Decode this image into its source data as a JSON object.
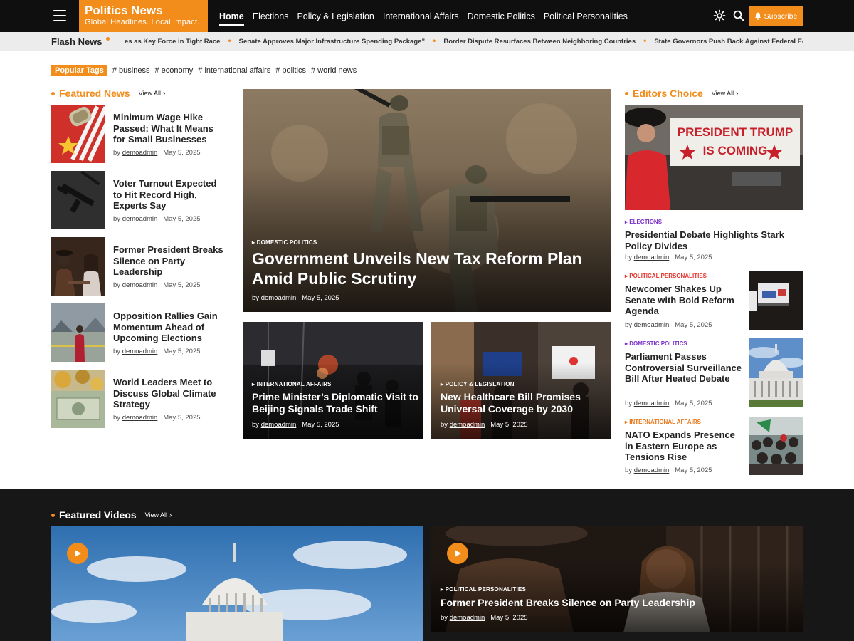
{
  "header": {
    "logo_title": "Politics News",
    "logo_subtitle": "Global Headlines. Local Impact.",
    "nav": [
      "Home",
      "Elections",
      "Policy & Legislation",
      "International Affairs",
      "Domestic Politics",
      "Political Personalities"
    ],
    "subscribe_label": "Subscribe",
    "accent_color": "#f28c1a"
  },
  "flash": {
    "label": "Flash News",
    "items": [
      "es as Key Force in Tight Race",
      "Senate Approves Major Infrastructure Spending Package”",
      "Border Dispute Resurfaces Between Neighboring Countries",
      "State Governors Push Back Against Federal Ed"
    ]
  },
  "tags": {
    "label": "Popular Tags",
    "items": [
      "# business",
      "# economy",
      "# international affairs",
      "# politics",
      "# world news"
    ]
  },
  "featured_news": {
    "title": "Featured News",
    "view_all": "View All",
    "items": [
      {
        "title": "Minimum Wage Hike Passed: What It Means for Small Businesses",
        "by": "by",
        "author": "demoadmin",
        "date": "May 5, 2025"
      },
      {
        "title": "Voter Turnout Expected to Hit Record High, Experts Say",
        "by": "by",
        "author": "demoadmin",
        "date": "May 5, 2025"
      },
      {
        "title": "Former President Breaks Silence on Party Leadership",
        "by": "by",
        "author": "demoadmin",
        "date": "May 5, 2025"
      },
      {
        "title": "Opposition Rallies Gain Momentum Ahead of Upcoming Elections",
        "by": "by",
        "author": "demoadmin",
        "date": "May 5, 2025"
      },
      {
        "title": "World Leaders Meet to Discuss Global Climate Strategy",
        "by": "by",
        "author": "demoadmin",
        "date": "May 5, 2025"
      }
    ]
  },
  "hero": {
    "category": "DOMESTIC POLITICS",
    "title": "Government Unveils New Tax Reform Plan Amid Public Scrutiny",
    "by": "by",
    "author": "demoadmin",
    "date": "May 5, 2025"
  },
  "sub_cards": [
    {
      "category": "INTERNATIONAL AFFAIRS",
      "title": "Prime Minister’s Diplomatic Visit to Beijing Signals Trade Shift",
      "by": "by",
      "author": "demoadmin",
      "date": "May 5, 2025"
    },
    {
      "category": "POLICY & LEGISLATION",
      "title": "New Healthcare Bill Promises Universal Coverage by 2030",
      "by": "by",
      "author": "demoadmin",
      "date": "May 5, 2025"
    }
  ],
  "editors_choice": {
    "title": "Editors Choice",
    "view_all": "View All",
    "lead": {
      "category": "ELECTIONS",
      "category_color": "#7a2fc7",
      "title": "Presidential Debate Highlights Stark Policy Divides",
      "by": "by",
      "author": "demoadmin",
      "date": "May 5, 2025",
      "image_text": "PRESIDENT TRUMP IS COMING"
    },
    "items": [
      {
        "category": "POLITICAL PERSONALITIES",
        "category_color": "#e2352f",
        "title": "Newcomer Shakes Up Senate with Bold Reform Agenda",
        "by": "by",
        "author": "demoadmin",
        "date": "May 5, 2025"
      },
      {
        "category": "DOMESTIC POLITICS",
        "category_color": "#7a2fc7",
        "title": "Parliament Passes Controversial Surveillance Bill After Heated Debate",
        "by": "by",
        "author": "demoadmin",
        "date": "May 5, 2025"
      },
      {
        "category": "INTERNATIONAL AFFAIRS",
        "category_color": "#e8771a",
        "title": "NATO Expands Presence in Eastern Europe as Tensions Rise",
        "by": "by",
        "author": "demoadmin",
        "date": "May 5, 2025"
      }
    ]
  },
  "videos": {
    "title": "Featured Videos",
    "view_all": "View All",
    "items": [
      {
        "category": "",
        "title": ""
      },
      {
        "category": "POLITICAL PERSONALITIES",
        "title": "Former President Breaks Silence on Party Leadership",
        "by": "by",
        "author": "demoadmin",
        "date": "May 5, 2025"
      }
    ]
  }
}
